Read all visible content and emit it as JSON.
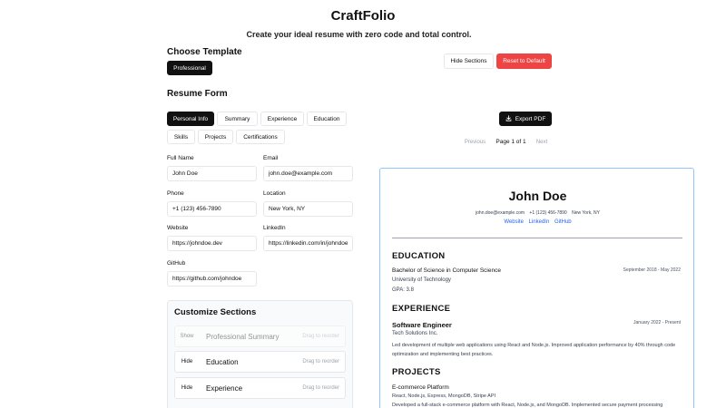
{
  "app": {
    "title": "CraftFolio",
    "subtitle": "Create your ideal resume with zero code and total control."
  },
  "template": {
    "heading": "Choose Template",
    "selected": "Professional"
  },
  "actions": {
    "hide_sections": "Hide Sections",
    "reset": "Reset to Default",
    "export_pdf": "Export PDF"
  },
  "form": {
    "heading": "Resume Form",
    "tabs": [
      "Personal Info",
      "Summary",
      "Experience",
      "Education",
      "Skills",
      "Projects",
      "Certifications"
    ],
    "active_tab": "Personal Info",
    "fields": {
      "full_name": {
        "label": "Full Name",
        "value": "John Doe"
      },
      "email": {
        "label": "Email",
        "value": "john.doe@example.com"
      },
      "phone": {
        "label": "Phone",
        "value": "+1 (123) 456-7890"
      },
      "location": {
        "label": "Location",
        "value": "New York, NY"
      },
      "website": {
        "label": "Website",
        "value": "https://johndoe.dev"
      },
      "linkedin": {
        "label": "LinkedIn",
        "value": "https://linkedin.com/in/johndoe"
      },
      "github": {
        "label": "GitHub",
        "value": "https://github.com/johndoe"
      }
    }
  },
  "customize": {
    "heading": "Customize Sections",
    "drag_hint": "Drag to reorder",
    "rows": [
      {
        "toggle": "Show",
        "name": "Professional Summary"
      },
      {
        "toggle": "Hide",
        "name": "Education"
      },
      {
        "toggle": "Hide",
        "name": "Experience"
      }
    ]
  },
  "pagination": {
    "previous": "Previous",
    "page": "Page 1 of 1",
    "next": "Next"
  },
  "preview": {
    "name": "John Doe",
    "email": "john.doe@example.com",
    "phone": "+1 (123) 456-7890",
    "location": "New York, NY",
    "links": [
      "Website",
      "LinkedIn",
      "GitHub"
    ],
    "education": {
      "heading": "EDUCATION",
      "degree": "Bachelor of Science in Computer Science",
      "dates": "September 2018 - May 2022",
      "school": "University of Technology",
      "gpa": "GPA: 3.8"
    },
    "experience": {
      "heading": "EXPERIENCE",
      "role": "Software Engineer",
      "dates": "January 2022 - Present",
      "company": "Tech Solutions Inc.",
      "desc": "Led development of multiple web applications using React and Node.js. Improved application performance by 40% through code optimization and implementing best practices."
    },
    "projects": {
      "heading": "PROJECTS",
      "name": "E-commerce Platform",
      "tech": "React, Node.js, Express, MongoDB, Stripe API",
      "desc": "Developed a full-stack e-commerce platform with React, Node.js, and MongoDB. Implemented secure payment processing"
    }
  },
  "colors": {
    "accent_dark": "#111111",
    "danger": "#ef4444",
    "link": "#2563eb",
    "preview_border": "#93c5fd"
  }
}
